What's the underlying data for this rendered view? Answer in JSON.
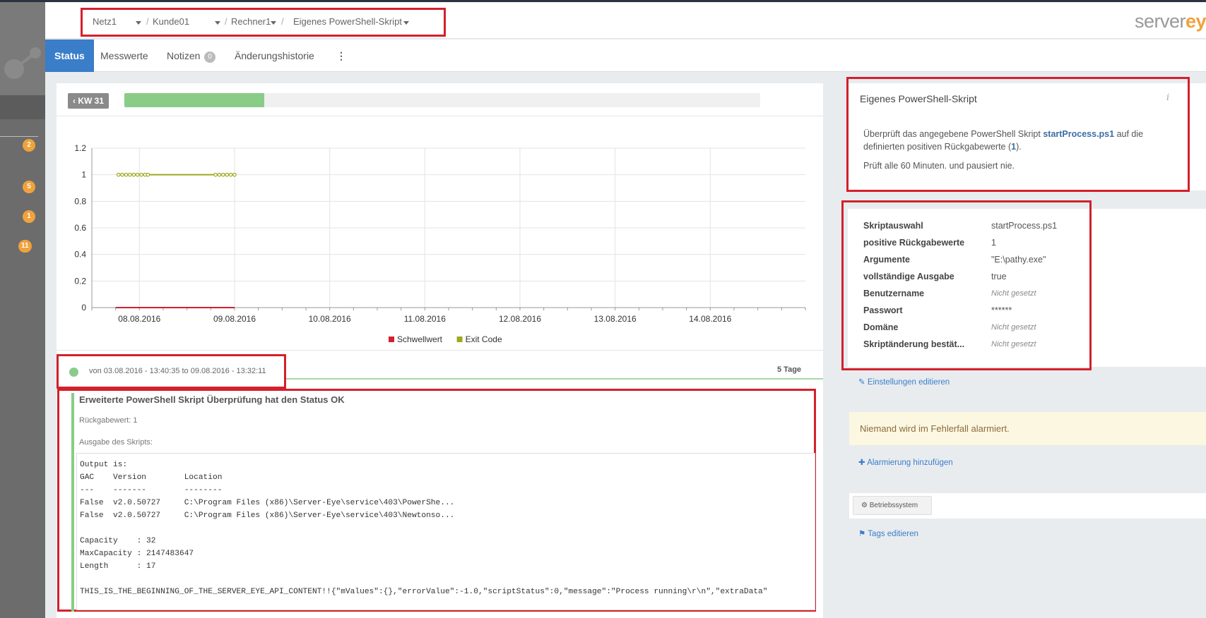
{
  "breadcrumb": [
    "Netz1",
    "Kunde01",
    "Rechner1",
    "Eigenes PowerShell-Skript"
  ],
  "brand": {
    "part1": "server",
    "part2": "ey"
  },
  "sidebar": {
    "badges": [
      "2",
      "5",
      "1",
      "11"
    ]
  },
  "tabs": [
    {
      "label": "Status",
      "active": true
    },
    {
      "label": "Messwerte"
    },
    {
      "label": "Notizen",
      "count": "0"
    },
    {
      "label": "Änderungshistorie"
    }
  ],
  "week": {
    "label": "KW 31",
    "progress": 0.22
  },
  "chart_data": {
    "type": "line",
    "x_labels": [
      "08.08.2016",
      "09.08.2016",
      "10.08.2016",
      "11.08.2016",
      "12.08.2016",
      "13.08.2016",
      "14.08.2016"
    ],
    "y_ticks": [
      "1.2",
      "1",
      "0.8",
      "0.6",
      "0.4",
      "0.2",
      "0"
    ],
    "ylim": [
      0,
      1.2
    ],
    "grid": true,
    "legend_position": "bottom",
    "series": [
      {
        "name": "Schwellwert",
        "color": "#d3202c",
        "points": [
          [
            7.75,
            0
          ],
          [
            9.0,
            0
          ]
        ]
      },
      {
        "name": "Exit Code",
        "color": "#9fa81c",
        "markers": true,
        "points": [
          [
            7.78,
            1
          ],
          [
            7.82,
            1
          ],
          [
            7.86,
            1
          ],
          [
            7.9,
            1
          ],
          [
            7.94,
            1
          ],
          [
            7.98,
            1
          ],
          [
            8.02,
            1
          ],
          [
            8.06,
            1
          ],
          [
            8.09,
            1
          ],
          [
            8.8,
            1
          ],
          [
            8.84,
            1
          ],
          [
            8.88,
            1
          ],
          [
            8.92,
            1
          ],
          [
            8.96,
            1
          ],
          [
            9.0,
            1
          ]
        ]
      }
    ]
  },
  "period": {
    "text": "von 03.08.2016 - 13:40:35 to 09.08.2016 - 13:32:11",
    "duration": "5 Tage"
  },
  "result": {
    "title": "Erweiterte PowerShell Skript Überprüfung hat den Status OK",
    "return_value": "Rückgabewert: 1",
    "output_label": "Ausgabe des Skripts:",
    "lines": [
      "Output is:",
      "GAC    Version        Location",
      "---    -------        --------",
      "False  v2.0.50727     C:\\Program Files (x86)\\Server-Eye\\service\\403\\PowerShe...",
      "False  v2.0.50727     C:\\Program Files (x86)\\Server-Eye\\service\\403\\Newtonso...",
      "",
      "Capacity    : 32",
      "MaxCapacity : 2147483647",
      "Length      : 17",
      "",
      "THIS_IS_THE_BEGINNING_OF_THE_SERVER_EYE_API_CONTENT!!{\"mValues\":{},\"errorValue\":-1.0,\"scriptStatus\":0,\"message\":\"Process running\\r\\n\",\"extraData\""
    ]
  },
  "sensor": {
    "title": "Eigenes PowerShell-Skript",
    "desc_before": "Überprüft das angegebene PowerShell Skript ",
    "script": "startProcess.ps1",
    "desc_middle": " auf die definierten positiven Rückgabewerte (",
    "values": "1",
    "desc_after": ").",
    "interval": "Prüft alle 60 Minuten. und pausiert nie."
  },
  "settings": [
    {
      "key": "Skriptauswahl",
      "value": "startProcess.ps1"
    },
    {
      "key": "positive Rückgabewerte",
      "value": "1"
    },
    {
      "key": "Argumente",
      "value": "\"E:\\pathy.exe\""
    },
    {
      "key": "vollständige Ausgabe",
      "value": "true"
    },
    {
      "key": "Benutzername",
      "value": "Nicht gesetzt",
      "unset": true
    },
    {
      "key": "Passwort",
      "value": "******"
    },
    {
      "key": "Domäne",
      "value": "Nicht gesetzt",
      "unset": true
    },
    {
      "key": "Skriptänderung bestät...",
      "value": "Nicht gesetzt",
      "unset": true
    }
  ],
  "links": {
    "edit_settings": "Einstellungen editieren",
    "alert_text": "Niemand wird im Fehlerfall alarmiert.",
    "add_alert": "Alarmierung hinzufügen",
    "tag": "Betriebssystem",
    "edit_tags": "Tags editieren"
  }
}
